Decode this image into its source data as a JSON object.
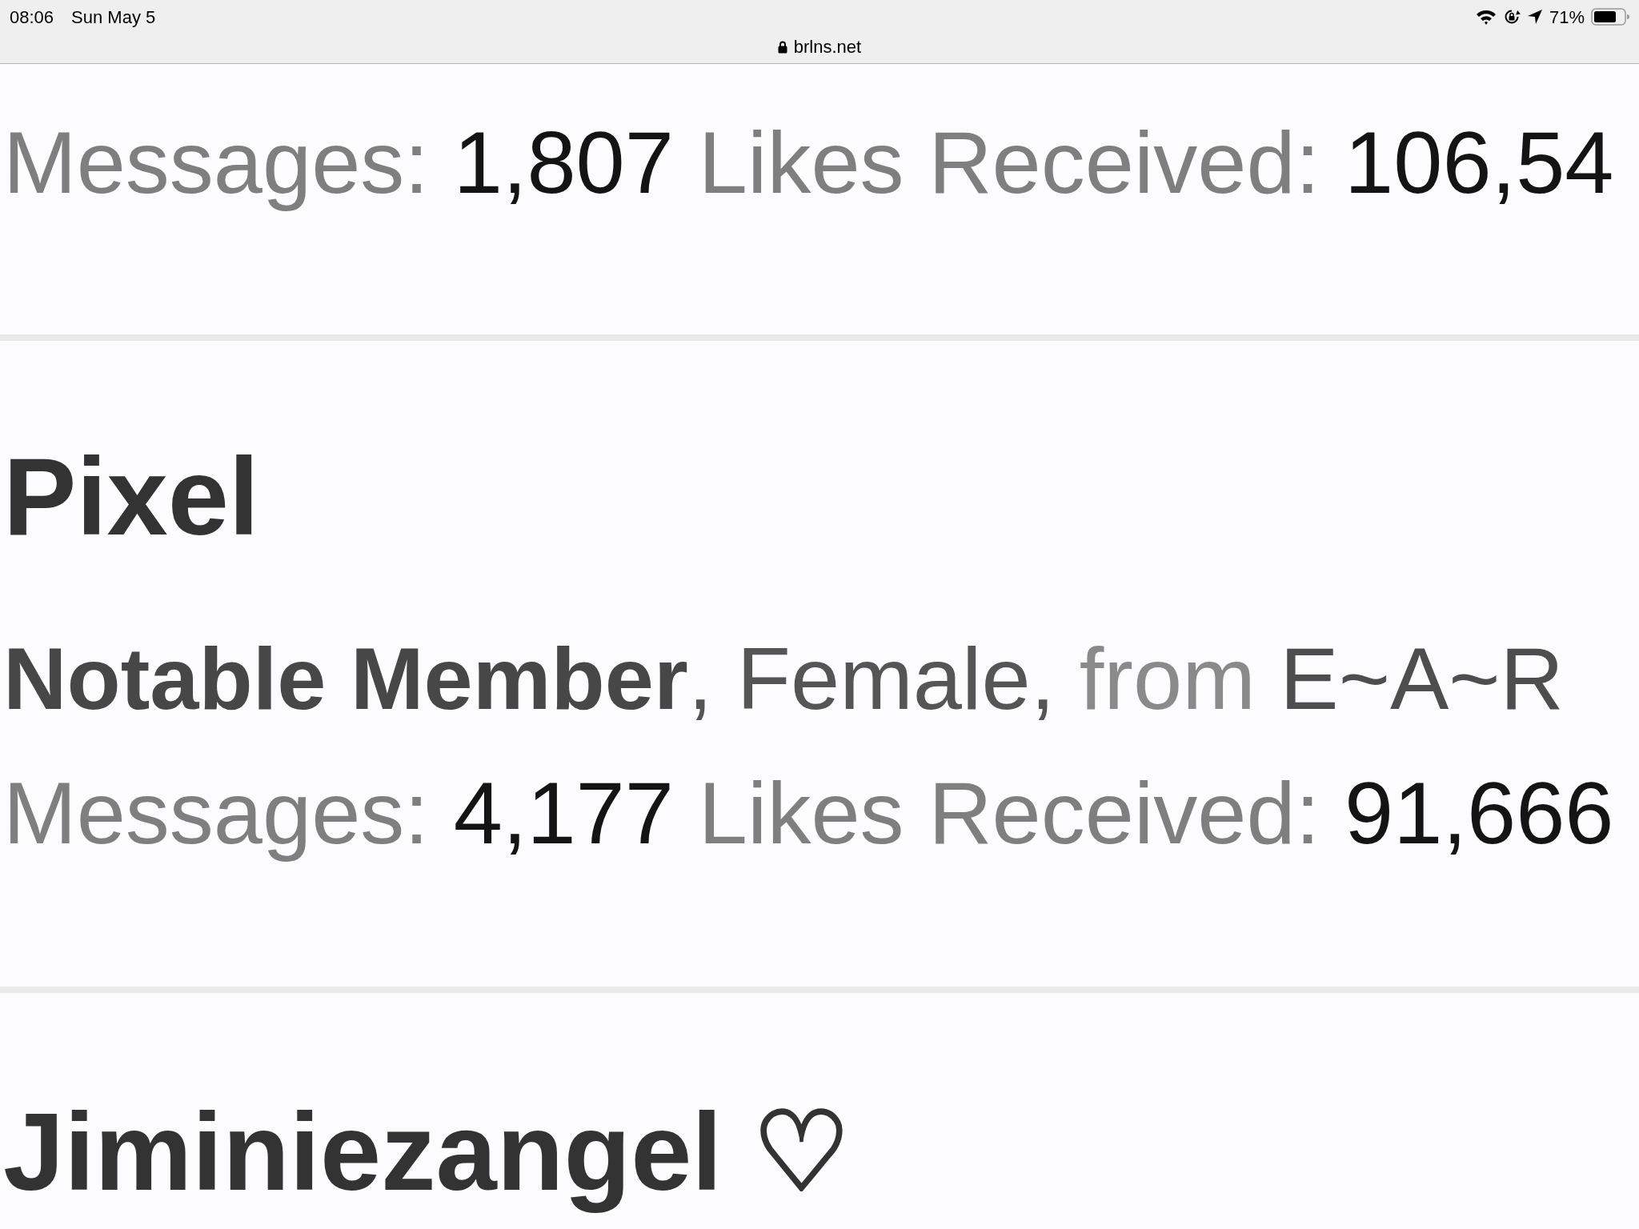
{
  "status_bar": {
    "time": "08:06",
    "date": "Sun May 5",
    "battery": "71%"
  },
  "address_bar": {
    "url": "brlns.net"
  },
  "members": [
    {
      "stats": [
        {
          "label": "Messages:",
          "value": "1,807"
        },
        {
          "label": "Likes Received:",
          "value": "106,54"
        }
      ]
    },
    {
      "name": "Pixel",
      "info": [
        {
          "kind": "title",
          "text": "Notable Member"
        },
        {
          "kind": "plain",
          "text": ", Female, "
        },
        {
          "kind": "muted",
          "text": "from "
        },
        {
          "kind": "location",
          "text": "E~A~R"
        }
      ],
      "stats": [
        {
          "label": "Messages:",
          "value": "4,177"
        },
        {
          "label": "Likes Received:",
          "value": "91,666"
        }
      ]
    },
    {
      "name": "Jiminiezangel ♡"
    }
  ]
}
